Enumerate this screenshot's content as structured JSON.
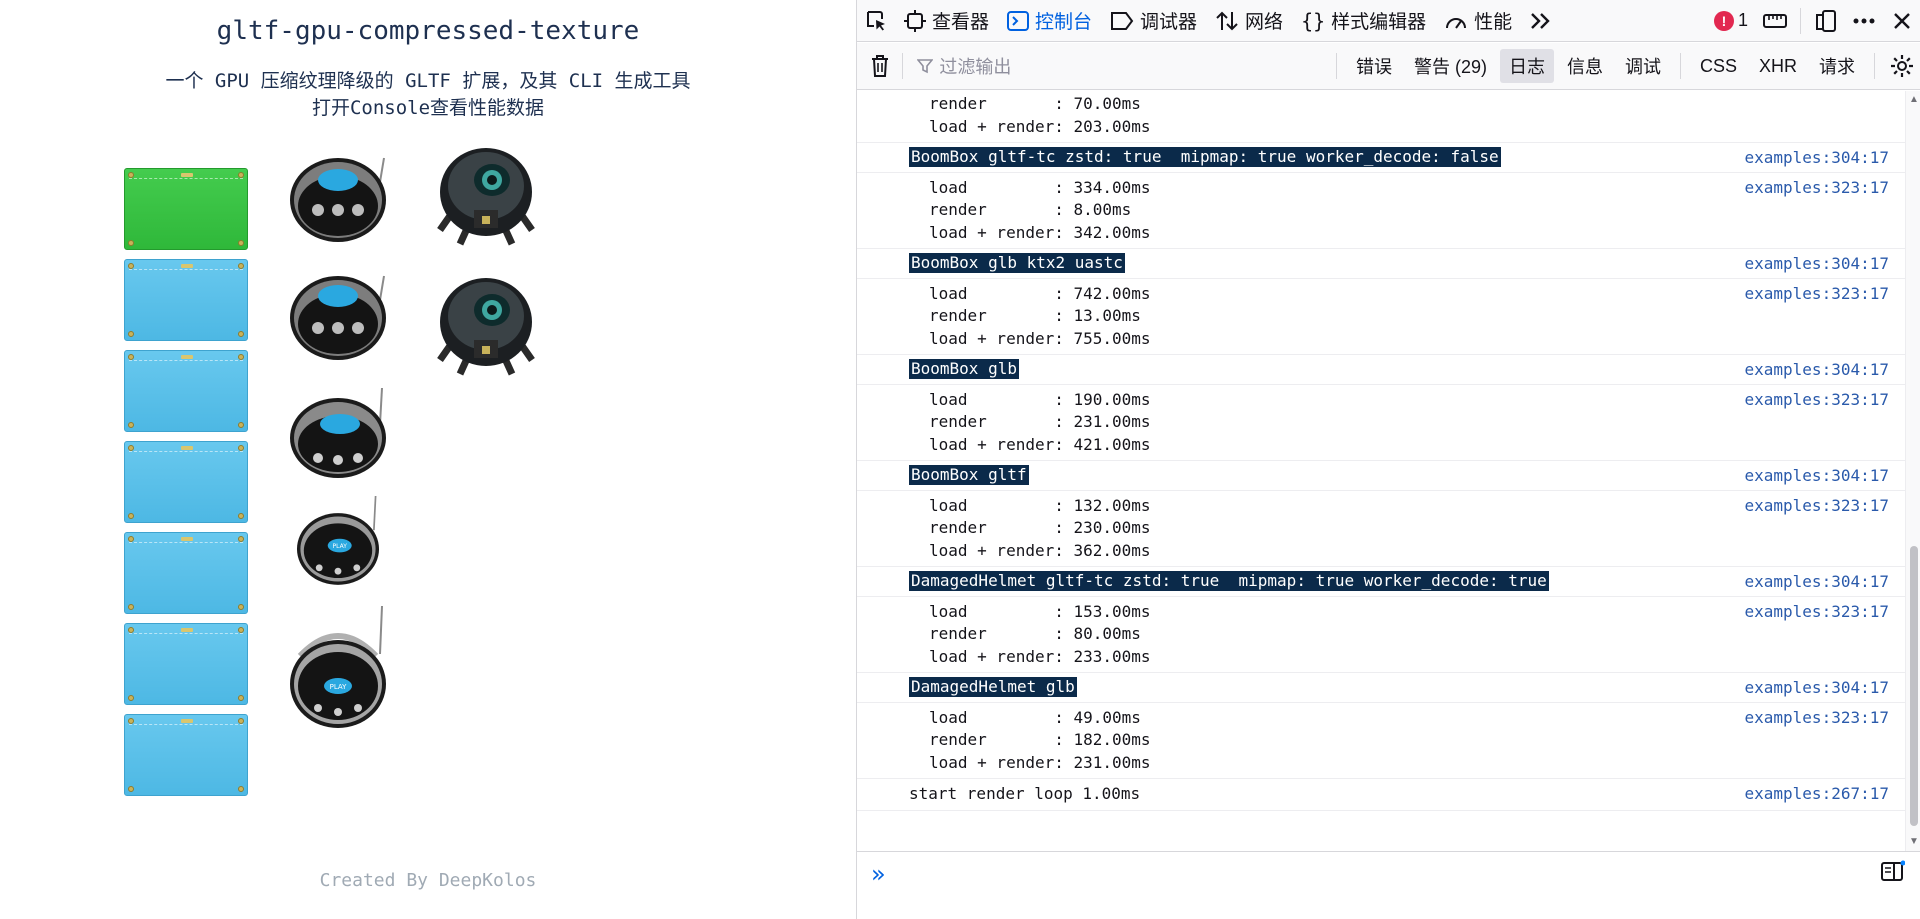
{
  "page": {
    "title": "gltf-gpu-compressed-texture",
    "subtitle1": "一个 GPU 压缩纹理降级的 GLTF 扩展，及其 CLI 生成工具",
    "subtitle2": "打开Console查看性能数据",
    "credit": "Created By DeepKolos",
    "boombox_label": "PLAY"
  },
  "devtools": {
    "tabs": [
      {
        "label": "查看器",
        "icon": "inspector-icon"
      },
      {
        "label": "控制台",
        "icon": "console-icon"
      },
      {
        "label": "调试器",
        "icon": "debugger-icon"
      },
      {
        "label": "网络",
        "icon": "network-icon"
      },
      {
        "label": "样式编辑器",
        "icon": "style-editor-icon"
      },
      {
        "label": "性能",
        "icon": "performance-icon"
      }
    ],
    "error_count": "1",
    "filter_placeholder": "过滤输出",
    "levels": [
      "错误",
      "警告 (29)",
      "日志",
      "信息",
      "调试"
    ],
    "types": [
      "CSS",
      "XHR",
      "请求"
    ],
    "accent_color": "#0061e0",
    "error_color": "#e22850"
  },
  "console": {
    "partial": [
      "render       : 70.00ms",
      "load + render: 203.00ms"
    ],
    "groups": [
      {
        "head": "BoomBox gltf-tc zstd: true  mipmap: true worker_decode: false",
        "head_loc": "examples:304:17",
        "lines": [
          "load         : 334.00ms",
          "render       : 8.00ms",
          "load + render: 342.00ms"
        ],
        "lines_loc": "examples:323:17"
      },
      {
        "head": "BoomBox glb ktx2 uastc",
        "head_loc": "examples:304:17",
        "lines": [
          "load         : 742.00ms",
          "render       : 13.00ms",
          "load + render: 755.00ms"
        ],
        "lines_loc": "examples:323:17"
      },
      {
        "head": "BoomBox glb",
        "head_loc": "examples:304:17",
        "lines": [
          "load         : 190.00ms",
          "render       : 231.00ms",
          "load + render: 421.00ms"
        ],
        "lines_loc": "examples:323:17"
      },
      {
        "head": "BoomBox gltf",
        "head_loc": "examples:304:17",
        "lines": [
          "load         : 132.00ms",
          "render       : 230.00ms",
          "load + render: 362.00ms"
        ],
        "lines_loc": "examples:323:17"
      },
      {
        "head": "DamagedHelmet gltf-tc zstd: true  mipmap: true worker_decode: true",
        "head_loc": "examples:304:17",
        "lines": [
          "load         : 153.00ms",
          "render       : 80.00ms",
          "load + render: 233.00ms"
        ],
        "lines_loc": "examples:323:17"
      },
      {
        "head": "DamagedHelmet glb",
        "head_loc": "examples:304:17",
        "lines": [
          "load         : 49.00ms",
          "render       : 182.00ms",
          "load + render: 231.00ms"
        ],
        "lines_loc": "examples:323:17"
      }
    ],
    "last": {
      "text": "start render loop 1.00ms",
      "loc": "examples:267:17"
    }
  }
}
